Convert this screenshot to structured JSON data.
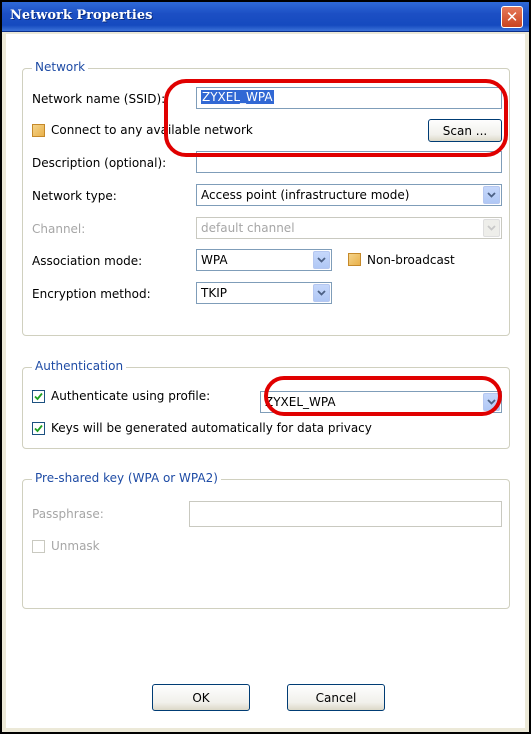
{
  "window": {
    "title": "Network Properties",
    "close_glyph": "✕"
  },
  "network": {
    "legend": "Network",
    "ssid_label": "Network name (SSID):",
    "ssid_value": "ZYXEL_WPA",
    "connect_any_label": "Connect to any available network",
    "connect_any_checked": false,
    "scan_label": "Scan ...",
    "description_label": "Description (optional):",
    "description_value": "",
    "network_type_label": "Network type:",
    "network_type_value": "Access point (infrastructure mode)",
    "channel_label": "Channel:",
    "channel_value": "default channel",
    "association_label": "Association mode:",
    "association_value": "WPA",
    "non_broadcast_label": "Non-broadcast",
    "non_broadcast_checked": false,
    "encryption_label": "Encryption method:",
    "encryption_value": "TKIP"
  },
  "authentication": {
    "legend": "Authentication",
    "auth_profile_label": "Authenticate using profile:",
    "auth_profile_checked": true,
    "profile_value": "ZYXEL_WPA",
    "keys_label": "Keys will be generated automatically for data privacy",
    "keys_checked": true
  },
  "psk": {
    "legend": "Pre-shared key (WPA or WPA2)",
    "passphrase_label": "Passphrase:",
    "passphrase_value": "",
    "unmask_label": "Unmask",
    "unmask_checked": false
  },
  "footer": {
    "ok_label": "OK",
    "cancel_label": "Cancel"
  },
  "colors": {
    "titlebar": "#1c4fc4",
    "legend_text": "#1f4ca5",
    "highlight_oval": "#e00000",
    "selection": "#3168d4"
  },
  "icons": {
    "close": "close-icon",
    "dropdown": "chevron-down-icon",
    "check": "check-icon"
  }
}
